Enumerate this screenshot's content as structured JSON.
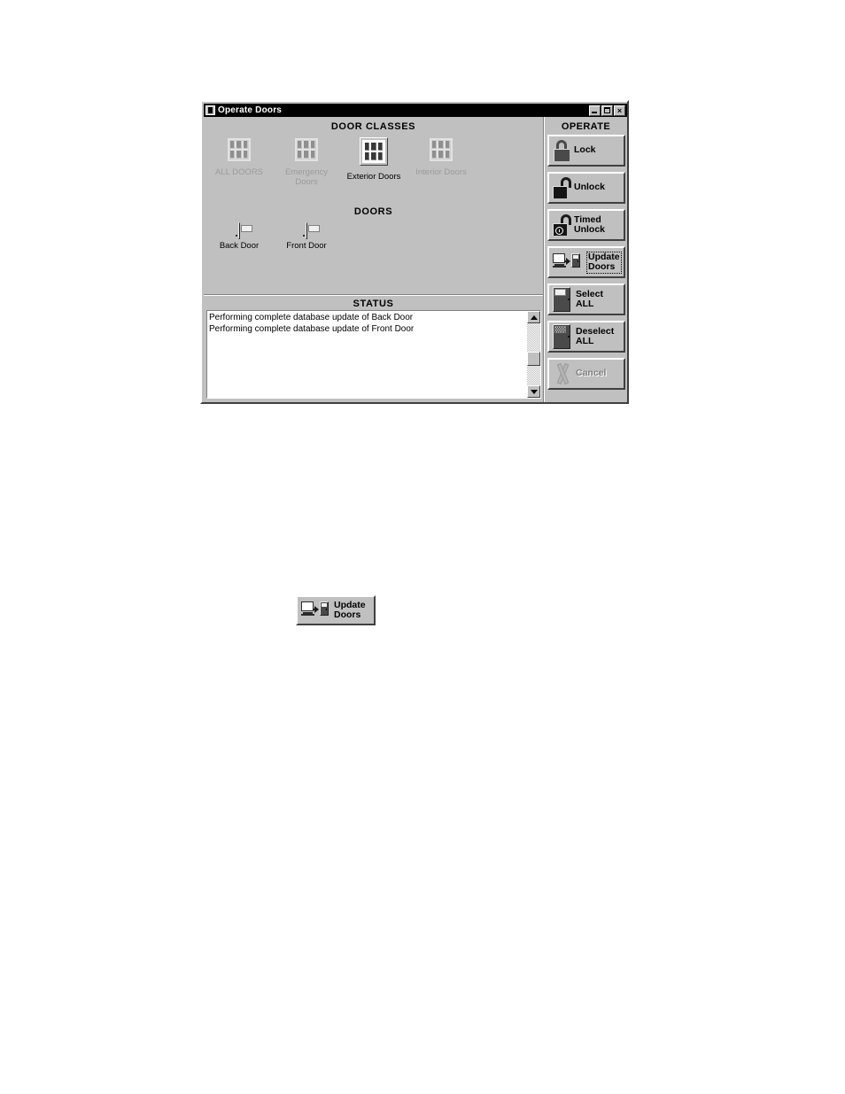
{
  "window": {
    "title": "Operate Doors",
    "title_icon": "app-window-icon",
    "controls": {
      "minimize": "minimize-icon",
      "maximize": "maximize-icon",
      "close": "×"
    }
  },
  "sections": {
    "door_classes_heading": "DOOR CLASSES",
    "doors_heading": "DOORS",
    "status_heading": "STATUS",
    "operate_heading": "OPERATE"
  },
  "door_classes": [
    {
      "label": "ALL DOORS",
      "state": "disabled",
      "selected": false
    },
    {
      "label": "Emergency\nDoors",
      "state": "disabled",
      "selected": false
    },
    {
      "label": "Exterior Doors",
      "state": "enabled",
      "selected": true
    },
    {
      "label": "Interior Doors",
      "state": "disabled",
      "selected": false
    }
  ],
  "doors": [
    {
      "label": "Back Door"
    },
    {
      "label": "Front Door"
    }
  ],
  "status_messages": [
    "Performing complete database update of Back Door",
    "Performing complete database update of Front Door"
  ],
  "operate_buttons": [
    {
      "label": "Lock",
      "icon": "padlock-closed-icon",
      "state": "enabled",
      "focused": false
    },
    {
      "label": "Unlock",
      "icon": "padlock-open-icon",
      "state": "enabled",
      "focused": false
    },
    {
      "label": "Timed\nUnlock",
      "icon": "padlock-clock-icon",
      "state": "enabled",
      "focused": false
    },
    {
      "label": "Update\nDoors",
      "icon": "computer-to-door-icon",
      "state": "enabled",
      "focused": true
    },
    {
      "label": "Select\nALL",
      "icon": "door-light-icon",
      "state": "enabled",
      "focused": false
    },
    {
      "label": "Deselect\nALL",
      "icon": "door-hatched-icon",
      "state": "enabled",
      "focused": false
    },
    {
      "label": "Cancel",
      "icon": "cancel-x-icon",
      "state": "disabled",
      "focused": false
    }
  ],
  "figure": {
    "label": "Update\nDoors",
    "icon": "computer-to-door-icon"
  },
  "colors": {
    "face": "#c0c0c0",
    "shadow": "#404040",
    "highlight": "#ffffff",
    "titlebar": "#000000",
    "disabled_text": "#9b9b9b",
    "text": "#000000",
    "list_background": "#ffffff"
  }
}
